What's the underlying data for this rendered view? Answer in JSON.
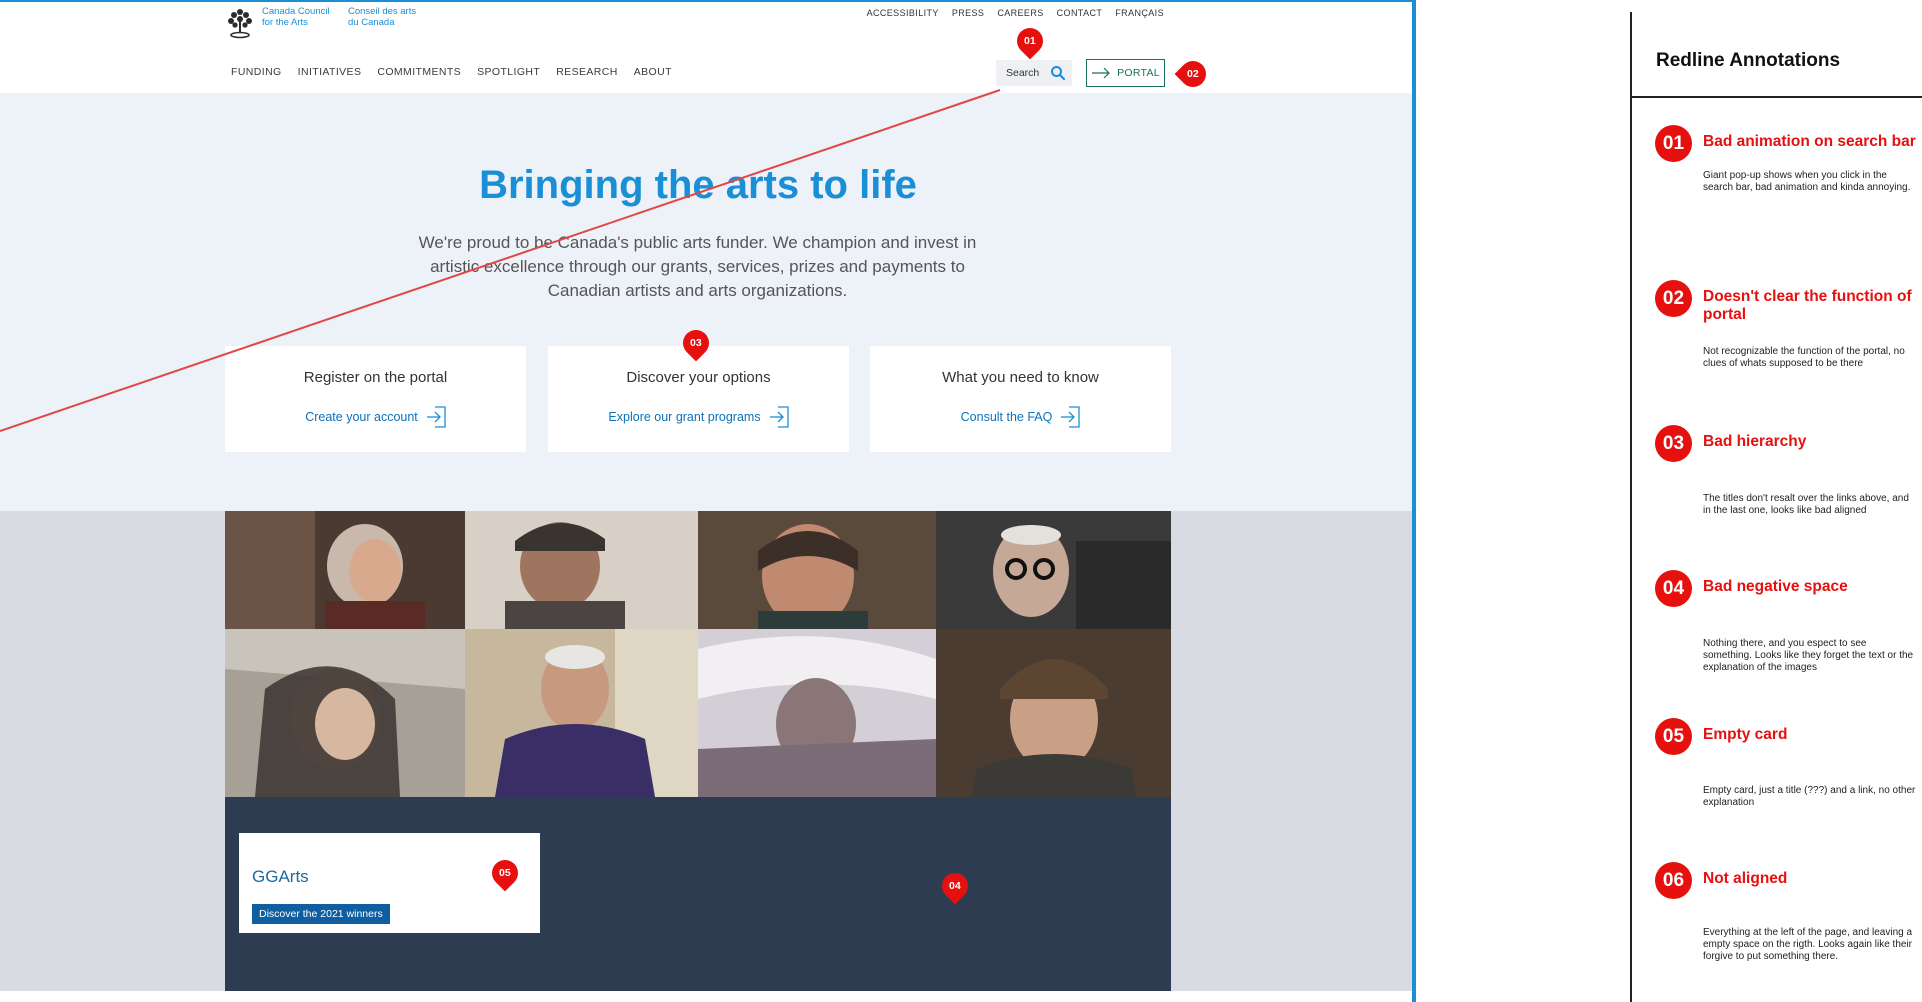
{
  "site": {
    "logo": {
      "en": "Canada Council for the Arts",
      "fr": "Conseil des arts du Canada"
    },
    "utility_nav": [
      "ACCESSIBILITY",
      "PRESS",
      "CAREERS",
      "CONTACT",
      "FRANÇAIS"
    ],
    "main_nav": [
      "FUNDING",
      "INITIATIVES",
      "COMMITMENTS",
      "SPOTLIGHT",
      "RESEARCH",
      "ABOUT"
    ],
    "search": {
      "label": "Search"
    },
    "portal": {
      "label": "PORTAL"
    },
    "hero": {
      "title": "Bringing the arts to life",
      "description": "We're proud to be Canada's public arts funder. We champion and invest in artistic excellence through our grants, services, prizes and payments to Canadian artists and arts organizations."
    },
    "cards": [
      {
        "title": "Register on the portal",
        "link": "Create your account"
      },
      {
        "title": "Discover your options",
        "link": "Explore our grant programs"
      },
      {
        "title": "What you need to know",
        "link": "Consult the FAQ"
      }
    ],
    "feature": {
      "title": "GGArts",
      "button": "Discover the 2021 winners"
    },
    "markers": [
      "01",
      "02",
      "03",
      "04",
      "05"
    ]
  },
  "annotations": {
    "title": "Redline Annotations",
    "items": [
      {
        "num": "01",
        "heading": "Bad animation on search bar",
        "body": "Giant pop-up shows when you click in the search bar, bad animation and kinda annoying."
      },
      {
        "num": "02",
        "heading": "Doesn't clear the function of portal",
        "body": "Not recognizable the function of the portal, no clues of whats supposed to be there"
      },
      {
        "num": "03",
        "heading": "Bad hierarchy",
        "body": "The titles don't resalt over the links above, and in the last one, looks like bad aligned"
      },
      {
        "num": "04",
        "heading": "Bad negative space",
        "body": "Nothing there, and you espect to see something. Looks like they forget the text or the explanation of the images"
      },
      {
        "num": "05",
        "heading": "Empty card",
        "body": " Empty card, just a title (???) and a link, no other explanation"
      },
      {
        "num": "06",
        "heading": "Not aligned",
        "body": "Everything at the left of the page, and leaving a empty space on the rigth. Looks again like their forgive to put something there."
      }
    ]
  },
  "colors": {
    "accent": "#1a8fd6",
    "marker": "#e6100f",
    "portal": "#1b6e5e",
    "dark_panel": "#2e3c51"
  }
}
